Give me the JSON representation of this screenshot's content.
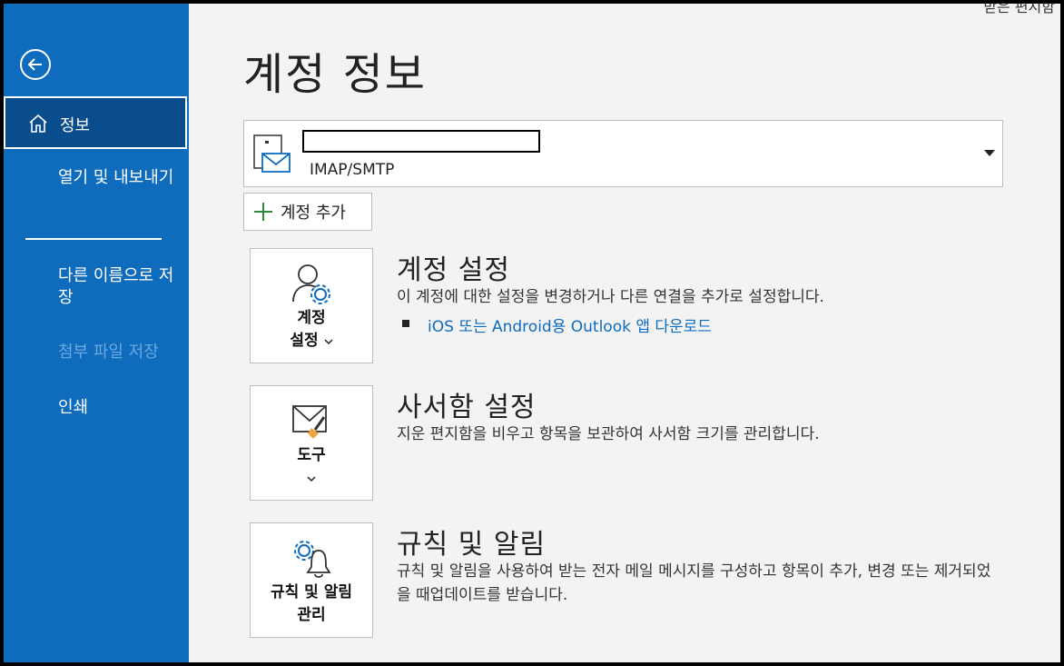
{
  "topright_text": "받은 편지함",
  "sidebar": {
    "items": [
      {
        "label": "정보",
        "active": true
      },
      {
        "label": "열기 및 내보내기"
      },
      {
        "label": "다른 이름으로 저장"
      },
      {
        "label": "첨부 파일 저장",
        "disabled": true
      },
      {
        "label": "인쇄"
      }
    ]
  },
  "page_title": "계정 정보",
  "account": {
    "email": "",
    "type": "IMAP/SMTP"
  },
  "add_account_label": "계정 추가",
  "sections": [
    {
      "card_label_1": "계정",
      "card_label_2": "설정",
      "title": "계정 설정",
      "desc": "이 계정에 대한 설정을 변경하거나 다른 연결을 추가로 설정합니다.",
      "link": "iOS 또는 Android용 Outlook 앱 다운로드"
    },
    {
      "card_label_1": "도구",
      "title": "사서함 설정",
      "desc": "지운 편지함을 비우고 항목을 보관하여 사서함 크기를 관리합니다."
    },
    {
      "card_label_1": "규칙 및 알림",
      "card_label_2": "관리",
      "title": "규칙 및 알림",
      "desc": "규칙 및 알림을 사용하여 받는 전자 메일 메시지를 구성하고 항목이 추가, 변경 또는 제거되었을 때업데이트를 받습니다."
    }
  ],
  "colors": {
    "sidebar": "#0f6cbd",
    "sidebar_active": "#0a4d8c",
    "link": "#0f6cbd"
  }
}
